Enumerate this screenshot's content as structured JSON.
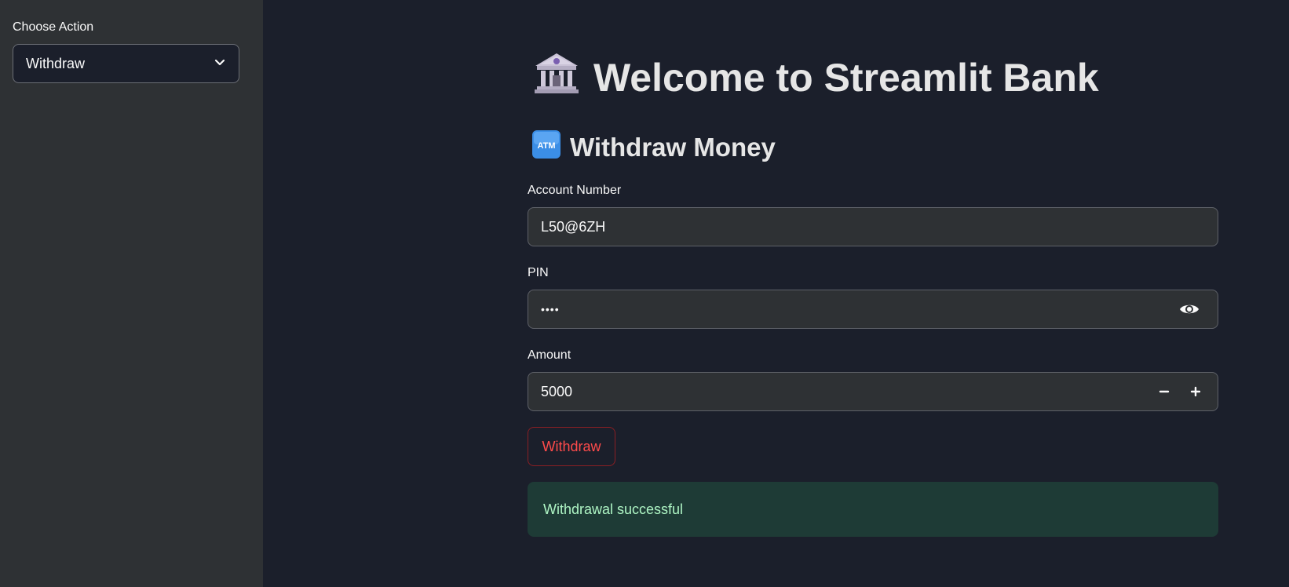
{
  "sidebar": {
    "label": "Choose Action",
    "select": {
      "value": "Withdraw"
    }
  },
  "main": {
    "title": "Welcome to Streamlit Bank",
    "title_icon": "bank-icon",
    "subtitle": "Withdraw Money",
    "subtitle_icon": "atm-icon",
    "fields": {
      "account": {
        "label": "Account Number",
        "value": "L50@6ZH"
      },
      "pin": {
        "label": "PIN",
        "value": "••••"
      },
      "amount": {
        "label": "Amount",
        "value": "5000"
      }
    },
    "button_label": "Withdraw",
    "alert": "Withdrawal successful"
  },
  "colors": {
    "background": "#1b1f2b",
    "sidebar": "#2e3134",
    "accent": "#ff4b4b",
    "success_bg": "#1e3b36",
    "success_text": "#aef5c4"
  }
}
